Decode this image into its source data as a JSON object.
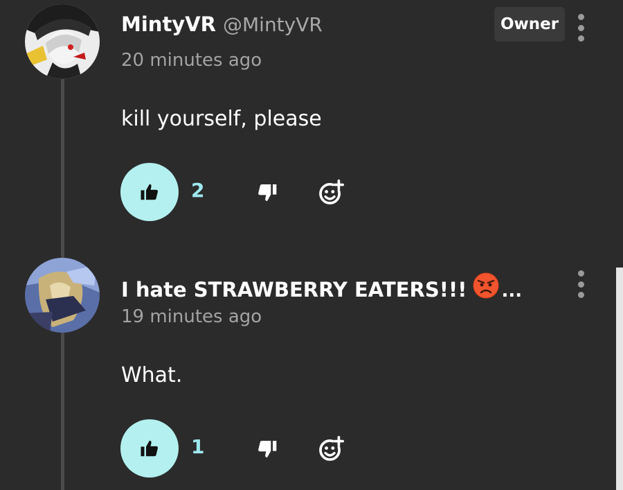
{
  "comments": [
    {
      "author": "MintyVR",
      "handle": "@MintyVR",
      "timestamp": "20 minutes ago",
      "badge": "Owner",
      "body": "kill yourself, please",
      "likes": "2"
    },
    {
      "author": "I hate STRAWBERRY EATERS!!!",
      "name_emoji": "angry-face-emoji",
      "name_truncation": "...",
      "timestamp": "19 minutes ago",
      "body": "What.",
      "likes": "1"
    }
  ],
  "icons": {
    "like": "thumbs-up-icon",
    "dislike": "thumbs-down-icon",
    "react": "add-reaction-icon",
    "menu": "more-vertical-icon"
  },
  "colors": {
    "background": "#2b2b2b",
    "like_button": "#b3f0ef",
    "like_count": "#9ee9ef",
    "secondary_text": "#a3a3a3",
    "badge_bg": "#3a3a3a"
  }
}
